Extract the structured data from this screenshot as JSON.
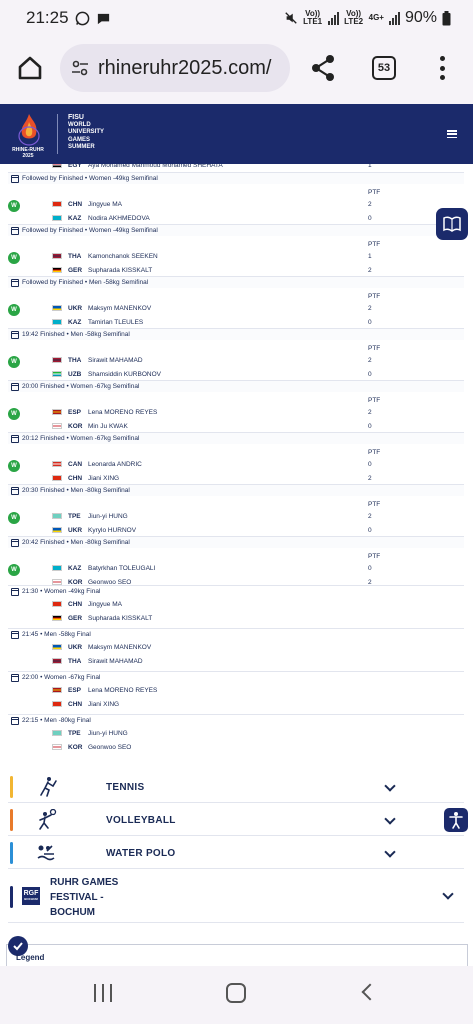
{
  "status_bar": {
    "time": "21:25",
    "battery": "90%",
    "sim1": "Vo)) LTE1",
    "sim2": "Vo)) LTE2",
    "network": "4G+"
  },
  "browser": {
    "url": "rhineruhr2025.com/",
    "tab_count": "53"
  },
  "site": {
    "logo_caption": "RHINE-RUHR 2025",
    "org_lines": [
      "FISU",
      "WORLD",
      "UNIVERSITY",
      "GAMES",
      "SUMMER"
    ]
  },
  "ptf_label": "PTF",
  "winner_badge": "W",
  "partial_row": {
    "code": "EGY",
    "name": "Aya Mohamed Mahmoud Mohamed SHEHATA",
    "score": "1"
  },
  "matches": [
    {
      "caption": "Followed by  Finished • Women -49kg Semifinal",
      "rows": [
        {
          "code": "CHN",
          "name": "Jingyue MA",
          "score": "2"
        },
        {
          "code": "KAZ",
          "name": "Nodira AKHMEDOVA",
          "score": "0"
        }
      ]
    },
    {
      "caption": "Followed by  Finished • Women -49kg Semifinal",
      "rows": [
        {
          "code": "THA",
          "name": "Kamonchanok SEEKEN",
          "score": "1"
        },
        {
          "code": "GER",
          "name": "Supharada KISSKALT",
          "score": "2"
        }
      ]
    },
    {
      "caption": "Followed by  Finished • Men -58kg Semifinal",
      "rows": [
        {
          "code": "UKR",
          "name": "Maksym MANENKOV",
          "score": "2"
        },
        {
          "code": "KAZ",
          "name": "Tamirlan TLEULES",
          "score": "0"
        }
      ]
    },
    {
      "caption": "19:42  Finished • Men -58kg Semifinal",
      "rows": [
        {
          "code": "THA",
          "name": "Sirawit MAHAMAD",
          "score": "2"
        },
        {
          "code": "UZB",
          "name": "Shamsiddin KURBONOV",
          "score": "0"
        }
      ]
    },
    {
      "caption": "20:00  Finished • Women -67kg Semifinal",
      "rows": [
        {
          "code": "ESP",
          "name": "Lena MORENO REYES",
          "score": "2"
        },
        {
          "code": "KOR",
          "name": "Min Ju KWAK",
          "score": "0"
        }
      ]
    },
    {
      "caption": "20:12  Finished • Women -67kg Semifinal",
      "rows": [
        {
          "code": "CAN",
          "name": "Leonarda ANDRIC",
          "score": "0"
        },
        {
          "code": "CHN",
          "name": "Jiani XING",
          "score": "2"
        }
      ]
    },
    {
      "caption": "20:30  Finished • Men -80kg Semifinal",
      "rows": [
        {
          "code": "TPE",
          "name": "Jiun-yi HUNG",
          "score": "2"
        },
        {
          "code": "UKR",
          "name": "Kyrylo HURNOV",
          "score": "0"
        }
      ]
    },
    {
      "caption": "20:42  Finished • Men -80kg Semifinal",
      "rows": [
        {
          "code": "KAZ",
          "name": "Batyrkhan TOLEUGALI",
          "score": "0"
        },
        {
          "code": "KOR",
          "name": "Geonwoo SEO",
          "score": "2"
        }
      ]
    }
  ],
  "finals": [
    {
      "caption": "21:30  • Women -49kg Final",
      "rows": [
        {
          "code": "CHN",
          "name": "Jingyue MA"
        },
        {
          "code": "GER",
          "name": "Supharada KISSKALT"
        }
      ]
    },
    {
      "caption": "21:45  • Men -58kg Final",
      "rows": [
        {
          "code": "UKR",
          "name": "Maksym MANENKOV"
        },
        {
          "code": "THA",
          "name": "Sirawit MAHAMAD"
        }
      ]
    },
    {
      "caption": "22:00  • Women -67kg Final",
      "rows": [
        {
          "code": "ESP",
          "name": "Lena MORENO REYES"
        },
        {
          "code": "CHN",
          "name": "Jiani XING"
        }
      ]
    },
    {
      "caption": "22:15  • Men -80kg Final",
      "rows": [
        {
          "code": "TPE",
          "name": "Jiun-yi HUNG"
        },
        {
          "code": "KOR",
          "name": "Geonwoo SEO"
        }
      ]
    }
  ],
  "sports": [
    {
      "label": "TENNIS",
      "color": "#f2b632",
      "icon": "tennis-icon"
    },
    {
      "label": "VOLLEYBALL",
      "color": "#e87a2a",
      "icon": "volleyball-icon"
    },
    {
      "label": "WATER POLO",
      "color": "#2b8fd6",
      "icon": "water-polo-icon"
    }
  ],
  "festival": {
    "badge_line1": "RGF",
    "badge_line2": "BOCHUM",
    "lines": [
      "RUHR GAMES",
      "FESTIVAL -",
      "BOCHUM"
    ],
    "color": "#1b2a6b"
  },
  "legend_label": "Legend",
  "flag_colors": {
    "EGY": [
      "#ce1126",
      "#ffffff",
      "#000000"
    ],
    "CHN": [
      "#de2910",
      "#de2910",
      "#de2910"
    ],
    "KAZ": [
      "#00afca",
      "#00afca",
      "#00afca"
    ],
    "THA": [
      "#a51931",
      "#2d2a4a",
      "#a51931"
    ],
    "GER": [
      "#000000",
      "#dd0000",
      "#ffce00"
    ],
    "UKR": [
      "#0057b7",
      "#0057b7",
      "#ffd700"
    ],
    "UZB": [
      "#1eb53a",
      "#ffffff",
      "#0099b5"
    ],
    "ESP": [
      "#aa151b",
      "#f1bf00",
      "#aa151b"
    ],
    "KOR": [
      "#ffffff",
      "#cd2e3a",
      "#ffffff"
    ],
    "CAN": [
      "#d52b1e",
      "#ffffff",
      "#d52b1e"
    ],
    "TPE": [
      "#6fd0c0",
      "#6fd0c0",
      "#6fd0c0"
    ]
  }
}
